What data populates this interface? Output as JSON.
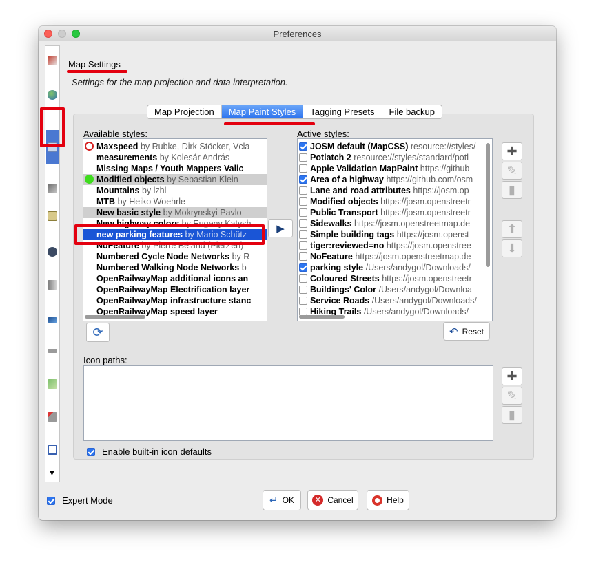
{
  "window": {
    "title": "Preferences"
  },
  "sidebar_icons": [
    "display-icon",
    "globe-icon",
    "map-paint-icon",
    "connection-icon",
    "plugin-icon",
    "shortcut-icon",
    "validator-icon",
    "remote-icon",
    "audio-icon",
    "imagery-icon",
    "advanced-icon",
    "tag-icon",
    "scroll-down-icon"
  ],
  "header": {
    "title": "Map Settings",
    "description": "Settings for the map projection and data interpretation."
  },
  "tabs": [
    {
      "label": "Map Projection",
      "active": false
    },
    {
      "label": "Map Paint Styles",
      "active": true
    },
    {
      "label": "Tagging Presets",
      "active": false
    },
    {
      "label": "File backup",
      "active": false
    }
  ],
  "available": {
    "label": "Available styles:",
    "items": [
      {
        "name": "Maxspeed",
        "meta": "by Rubke, Dirk Stöcker, Vcla",
        "icon": "maxspeed-icon",
        "state": "normal"
      },
      {
        "name": "measurements",
        "meta": "by Kolesár András",
        "icon": "",
        "state": "normal"
      },
      {
        "name": "Missing Maps / Youth Mappers Valic",
        "meta": "",
        "icon": "",
        "state": "normal"
      },
      {
        "name": "Modified objects",
        "meta": "by Sebastian Klein",
        "icon": "green-dot-icon",
        "state": "dim"
      },
      {
        "name": "Mountains",
        "meta": "by lzhl",
        "icon": "",
        "state": "normal"
      },
      {
        "name": "MTB",
        "meta": "by Heiko Woehrle",
        "icon": "",
        "state": "normal"
      },
      {
        "name": "New basic style",
        "meta": "by Mokrynskyi Pavlo",
        "icon": "",
        "state": "dim"
      },
      {
        "name": "New highway colors",
        "meta": "by Eugeny Katysh",
        "icon": "",
        "state": "normal"
      },
      {
        "name": "new parking features",
        "meta": "by Mario Schütz",
        "icon": "",
        "state": "sel"
      },
      {
        "name": "NoFeature",
        "meta": "by Pierre Béland (PierZen)",
        "icon": "",
        "state": "normal"
      },
      {
        "name": "Numbered Cycle Node Networks",
        "meta": "by R",
        "icon": "",
        "state": "normal"
      },
      {
        "name": "Numbered Walking Node Networks",
        "meta": "b",
        "icon": "",
        "state": "normal"
      },
      {
        "name": "OpenRailwayMap additional icons an",
        "meta": "",
        "icon": "",
        "state": "normal"
      },
      {
        "name": "OpenRailwayMap Electrification layer",
        "meta": "",
        "icon": "",
        "state": "normal"
      },
      {
        "name": "OpenRailwayMap infrastructure stanc",
        "meta": "",
        "icon": "",
        "state": "normal"
      },
      {
        "name": "OpenRailwayMap speed layer",
        "meta": "",
        "icon": "",
        "state": "normal"
      }
    ]
  },
  "active": {
    "label": "Active styles:",
    "items": [
      {
        "name": "JOSM default (MapCSS)",
        "meta": "resource://styles/",
        "checked": true
      },
      {
        "name": "Potlatch 2",
        "meta": "resource://styles/standard/potl",
        "checked": false
      },
      {
        "name": "Apple Validation MapPaint",
        "meta": "https://github",
        "checked": false
      },
      {
        "name": "Area of a highway",
        "meta": "https://github.com/osm",
        "checked": true
      },
      {
        "name": "Lane and road attributes",
        "meta": "https://josm.op",
        "checked": false
      },
      {
        "name": "Modified objects",
        "meta": "https://josm.openstreetr",
        "checked": false
      },
      {
        "name": "Public Transport",
        "meta": "https://josm.openstreetr",
        "checked": false
      },
      {
        "name": "Sidewalks",
        "meta": "https://josm.openstreetmap.de",
        "checked": false
      },
      {
        "name": "Simple building tags",
        "meta": "https://josm.openst",
        "checked": false
      },
      {
        "name": "tiger:reviewed=no",
        "meta": "https://josm.openstree",
        "checked": false
      },
      {
        "name": "NoFeature",
        "meta": "https://josm.openstreetmap.de",
        "checked": false
      },
      {
        "name": "parking style",
        "meta": "/Users/andygol/Downloads/",
        "checked": true
      },
      {
        "name": "Coloured Streets",
        "meta": "https://josm.openstreetr",
        "checked": false
      },
      {
        "name": "Buildings' Color",
        "meta": "/Users/andygol/Downloa",
        "checked": false
      },
      {
        "name": "Service Roads",
        "meta": "/Users/andygol/Downloads/",
        "checked": false
      },
      {
        "name": "Hiking Trails",
        "meta": "/Users/andygol/Downloads/",
        "checked": false
      }
    ]
  },
  "buttons": {
    "reset": "Reset",
    "ok": "OK",
    "cancel": "Cancel",
    "help": "Help"
  },
  "icon_paths": {
    "label": "Icon paths:"
  },
  "checkboxes": {
    "builtin_icons": {
      "label": "Enable built-in icon defaults",
      "checked": true
    },
    "expert_mode": {
      "label": "Expert Mode",
      "checked": true
    }
  },
  "colors": {
    "selection": "#1a55d6",
    "tab_active": "#2d73ee",
    "annotation": "#e3000f"
  }
}
